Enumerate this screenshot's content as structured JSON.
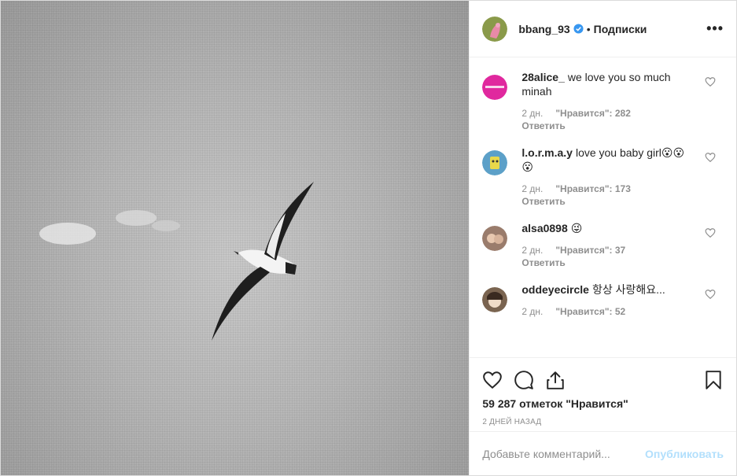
{
  "post": {
    "author": "bbang_93",
    "separator": "•",
    "follow_label": "Подписки",
    "more_label": "•••"
  },
  "comments": [
    {
      "user": "28alice_",
      "text": "we love you so much minah",
      "age": "2 дн.",
      "likes": "\"Нравится\": 282",
      "reply": "Ответить",
      "avatar_color": "#e0289e"
    },
    {
      "user": "l.o.r.m.a.y",
      "text": "love you baby girl😮😮😮",
      "age": "2 дн.",
      "likes": "\"Нравится\": 173",
      "reply": "Ответить",
      "avatar_color": "#5ca0c8"
    },
    {
      "user": "alsa0898",
      "text": "😜",
      "age": "2 дн.",
      "likes": "\"Нравится\": 37",
      "reply": "Ответить",
      "avatar_color": "#9a7c6c"
    },
    {
      "user": "oddeyecircle",
      "text": "항상 사랑해요...",
      "age": "2 дн.",
      "likes": "\"Нравится\": 52",
      "reply": "",
      "avatar_color": "#7a6450"
    }
  ],
  "stats": {
    "likes": "59 287 отметок \"Нравится\"",
    "date": "2 ДНЕЙ НАЗАД"
  },
  "composer": {
    "placeholder": "Добавьте комментарий...",
    "post_label": "Опубликовать"
  },
  "colors": {
    "verified": "#3897f0",
    "post_disabled": "#b2dffc"
  }
}
